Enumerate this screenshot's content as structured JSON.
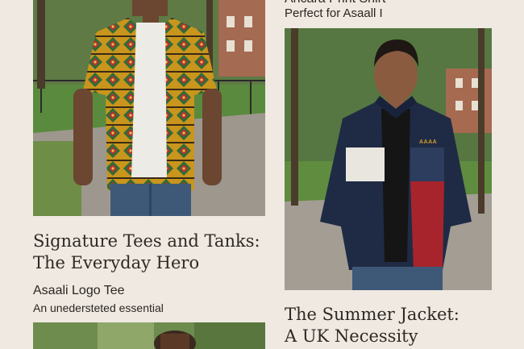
{
  "left_column": {
    "section_heading": {
      "line1": "Signature Tees and Tanks:",
      "line2": "The Everyday Hero"
    },
    "product": {
      "name": "Asaali Logo Tee",
      "description": "An unedersteted essential"
    }
  },
  "right_column": {
    "top_product": {
      "name": "Ancara Print Shirt",
      "description": "Perfect for Asaall I"
    },
    "section_heading": {
      "line1": "The Summer Jacket:",
      "line2": "A UK Necessity"
    },
    "jacket_logo": "AAAA"
  },
  "colors": {
    "background": "#efe9e1",
    "text": "#2b2622",
    "jacket_navy": "#1f2b45",
    "jacket_red": "#a8242c",
    "jacket_white": "#e9e6df"
  }
}
